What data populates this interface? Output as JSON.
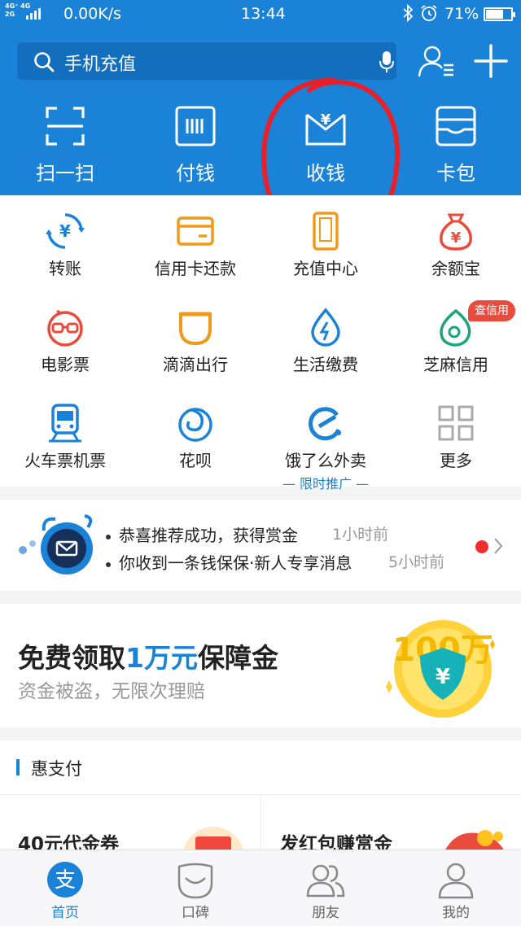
{
  "status_bar": {
    "network": [
      "4G⁺ 4G",
      "2G"
    ],
    "speed": "0.00K/s",
    "time": "13:44",
    "battery": "71%",
    "battery_level": 0.71
  },
  "header": {
    "search_placeholder": "手机充值",
    "quick_actions": [
      {
        "label": "扫一扫",
        "icon": "scan-icon"
      },
      {
        "label": "付钱",
        "icon": "pay-code-icon"
      },
      {
        "label": "收钱",
        "icon": "collect-money-icon"
      },
      {
        "label": "卡包",
        "icon": "card-wallet-icon"
      }
    ]
  },
  "apps": [
    {
      "label": "转账",
      "icon": "transfer-icon"
    },
    {
      "label": "信用卡还款",
      "icon": "credit-card-icon"
    },
    {
      "label": "充值中心",
      "icon": "phone-recharge-icon"
    },
    {
      "label": "余额宝",
      "icon": "money-bag-icon"
    },
    {
      "label": "电影票",
      "icon": "movie-glasses-icon"
    },
    {
      "label": "滴滴出行",
      "icon": "didi-icon"
    },
    {
      "label": "生活缴费",
      "icon": "utility-drop-icon"
    },
    {
      "label": "芝麻信用",
      "icon": "sesame-credit-icon"
    },
    {
      "label": "火车票机票",
      "icon": "train-icon"
    },
    {
      "label": "花呗",
      "icon": "huabei-icon"
    },
    {
      "label": "饿了么外卖",
      "icon": "eleme-icon",
      "sub": "— 限时推广 —"
    },
    {
      "label": "更多",
      "icon": "more-grid-icon"
    }
  ],
  "badge": "查信用",
  "notifications": [
    {
      "text": "恭喜推荐成功，获得赏金",
      "time": "1小时前"
    },
    {
      "text": "你收到一条钱保保·新人专享消息",
      "time": "5小时前"
    }
  ],
  "promo": {
    "title_a": "免费领取",
    "title_b": "1万元",
    "title_c": "保障金",
    "subtitle": "资金被盗，无限次理赔",
    "art_text": "100万"
  },
  "section": {
    "heading": "惠支付",
    "cards": [
      "40元代金券",
      "发红包赚赏金"
    ]
  },
  "tabs": [
    {
      "label": "首页",
      "icon": "alipay-home-icon",
      "active": true
    },
    {
      "label": "口碑",
      "icon": "koubei-icon",
      "active": false
    },
    {
      "label": "朋友",
      "icon": "friends-icon",
      "active": false
    },
    {
      "label": "我的",
      "icon": "profile-icon",
      "active": false
    }
  ],
  "colors": {
    "brand_blue": "#1a82d7",
    "annotation_red": "#e8202a",
    "badge_red": "#e94b3c"
  }
}
